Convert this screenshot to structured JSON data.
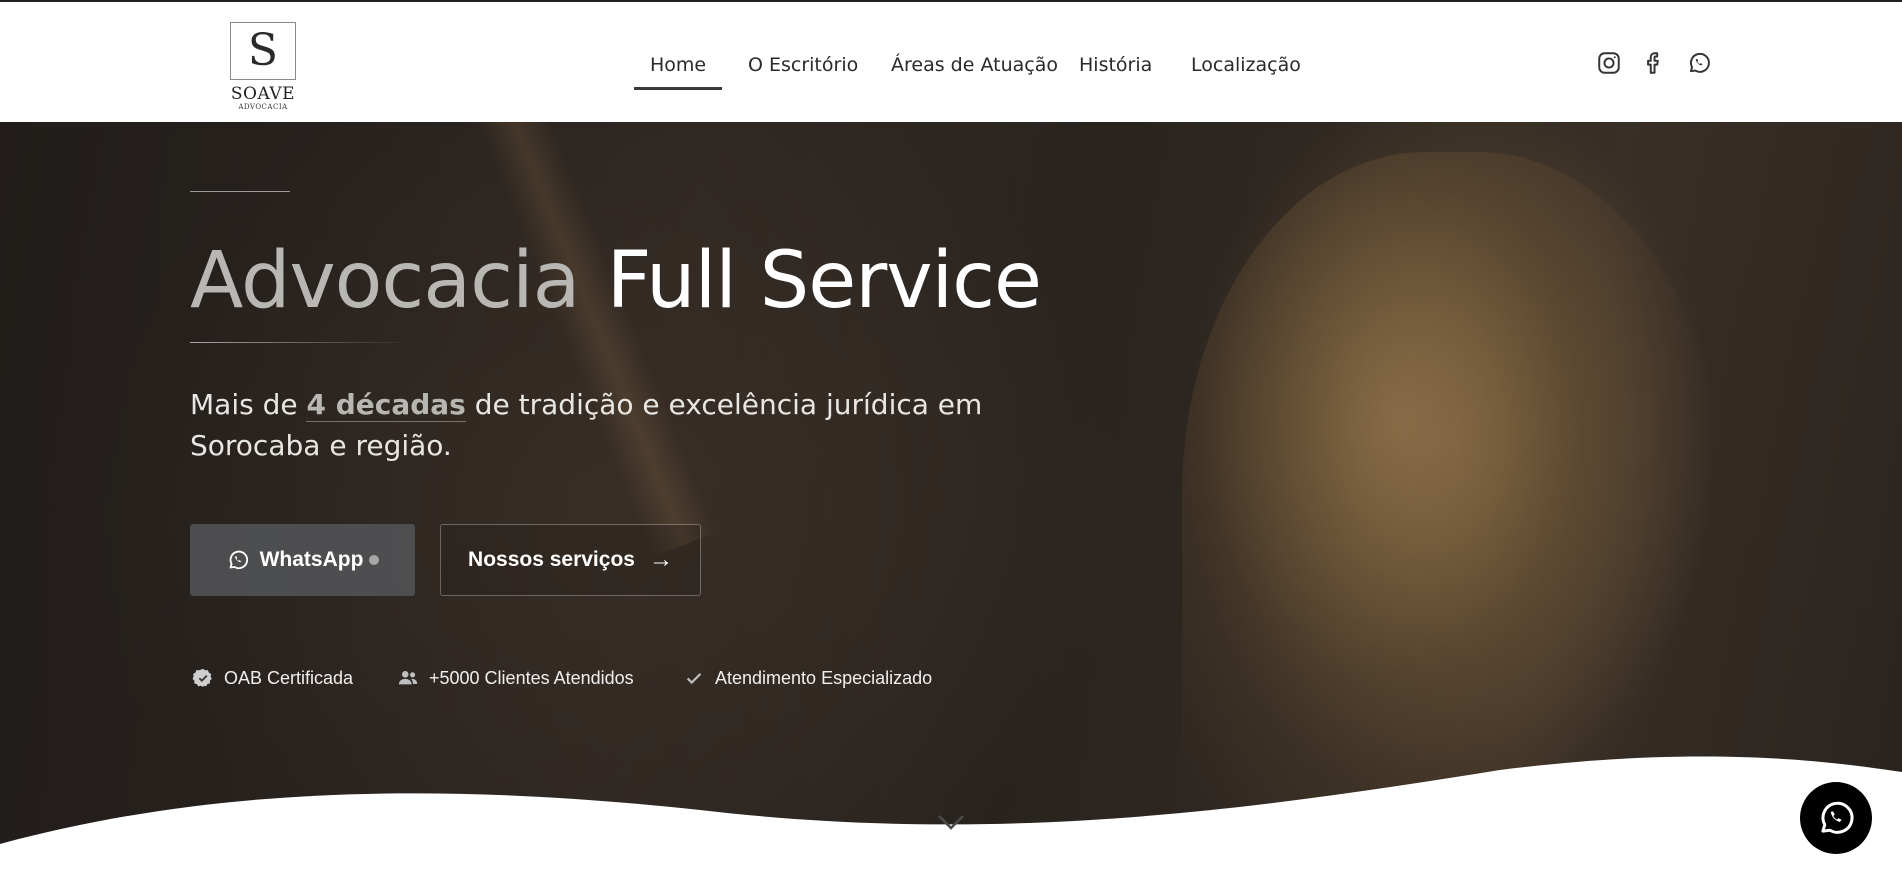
{
  "header": {
    "logo": {
      "mark": "S",
      "name": "SOAVE",
      "sub": "ADVOCACIA"
    },
    "nav": [
      {
        "label": "Home",
        "active": true
      },
      {
        "label": "O Escritório",
        "active": false
      },
      {
        "label": "Áreas de Atuação",
        "active": false
      },
      {
        "label": "História",
        "active": false
      },
      {
        "label": "Localização",
        "active": false
      }
    ],
    "social_icons": [
      "instagram-icon",
      "facebook-icon",
      "whatsapp-icon"
    ]
  },
  "hero": {
    "headline_light": "Advocacia",
    "headline_bold": "Full Service",
    "subtitle_pre": "Mais de ",
    "subtitle_highlight": "4 décadas",
    "subtitle_post": " de tradição e excelência jurídica em Sorocaba e região.",
    "buttons": {
      "whatsapp_label": "WhatsApp",
      "services_label": "Nossos serviços",
      "services_arrow": "→"
    },
    "badges": [
      {
        "icon": "check-circle-icon",
        "label": "OAB Certificada"
      },
      {
        "icon": "users-icon",
        "label": "+5000 Clientes Atendidos"
      },
      {
        "icon": "check-icon",
        "label": "Atendimento Especializado"
      }
    ],
    "scroll_icon": "chevron-down-icon"
  },
  "floating_button": {
    "icon": "whatsapp-icon"
  },
  "colors": {
    "header_bg": "#ffffff",
    "text_dark": "#2a2a2a",
    "hero_dark": "#2c2622",
    "bronze": "#a88450",
    "float_bg": "#000000"
  }
}
